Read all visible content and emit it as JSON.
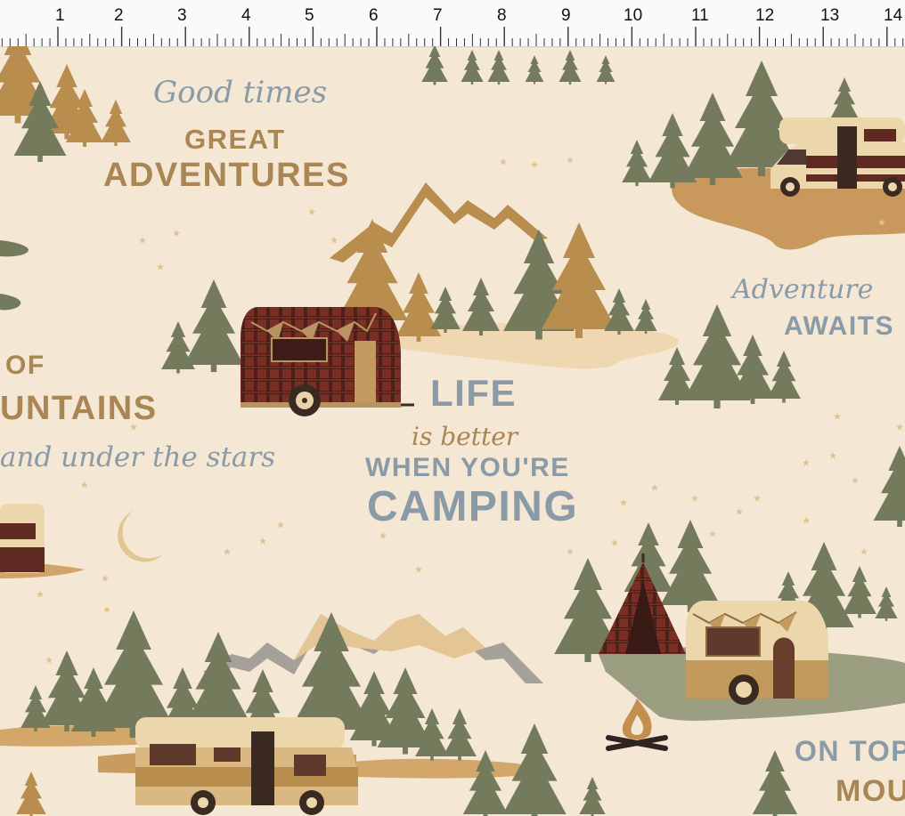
{
  "ruler": {
    "marks": [
      "1",
      "2",
      "3",
      "4",
      "5",
      "6",
      "7",
      "8",
      "9",
      "10",
      "11",
      "12",
      "13",
      "14"
    ]
  },
  "phrases": {
    "good_times": "Good times",
    "great": "GREAT",
    "adventures": "ADVENTURES",
    "adventure_script": "Adventure",
    "awaits": "AWAITS",
    "of": "OF",
    "untains": "UNTAINS",
    "under_stars": "and under the stars",
    "life": "LIFE",
    "is_better": "is better",
    "when_youre": "WHEN YOU'RE",
    "camping": "CAMPING",
    "on_top": "ON TOP",
    "mou": "MOU"
  },
  "colors": {
    "background": "#f4e7d3",
    "tree_green": "#737b5c",
    "tree_tan": "#b88d4e",
    "ground_tan": "#d3a76a",
    "text_blue": "#8a9aa6",
    "text_brown": "#a98653",
    "plaid_red": "#6d2b22",
    "camper_cream": "#ecd7ad"
  }
}
